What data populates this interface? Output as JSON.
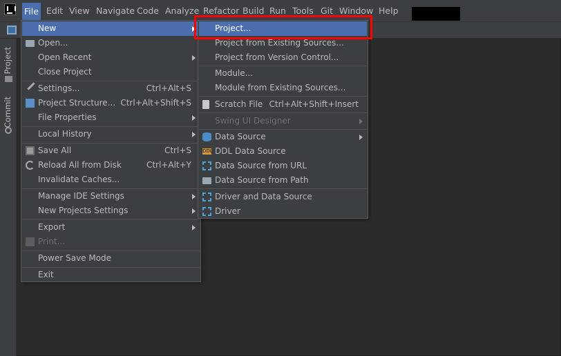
{
  "menubar": {
    "items": [
      {
        "label": "File"
      },
      {
        "label": "Edit"
      },
      {
        "label": "View"
      },
      {
        "label": "Navigate"
      },
      {
        "label": "Code"
      },
      {
        "label": "Analyze"
      },
      {
        "label": "Refactor"
      },
      {
        "label": "Build"
      },
      {
        "label": "Run"
      },
      {
        "label": "Tools"
      },
      {
        "label": "Git"
      },
      {
        "label": "Window"
      },
      {
        "label": "Help"
      }
    ]
  },
  "sidebar": {
    "tabs": [
      {
        "label": "Project"
      },
      {
        "label": "Commit"
      }
    ]
  },
  "file_menu": {
    "items": [
      {
        "label": "New",
        "shortcut": ""
      },
      {
        "label": "Open...",
        "shortcut": ""
      },
      {
        "label": "Open Recent",
        "shortcut": ""
      },
      {
        "label": "Close Project",
        "shortcut": ""
      },
      {
        "label": "Settings...",
        "shortcut": "Ctrl+Alt+S"
      },
      {
        "label": "Project Structure...",
        "shortcut": "Ctrl+Alt+Shift+S"
      },
      {
        "label": "File Properties",
        "shortcut": ""
      },
      {
        "label": "Local History",
        "shortcut": ""
      },
      {
        "label": "Save All",
        "shortcut": "Ctrl+S"
      },
      {
        "label": "Reload All from Disk",
        "shortcut": "Ctrl+Alt+Y"
      },
      {
        "label": "Invalidate Caches...",
        "shortcut": ""
      },
      {
        "label": "Manage IDE Settings",
        "shortcut": ""
      },
      {
        "label": "New Projects Settings",
        "shortcut": ""
      },
      {
        "label": "Export",
        "shortcut": ""
      },
      {
        "label": "Print...",
        "shortcut": ""
      },
      {
        "label": "Power Save Mode",
        "shortcut": ""
      },
      {
        "label": "Exit",
        "shortcut": ""
      }
    ]
  },
  "new_menu": {
    "items": [
      {
        "label": "Project...",
        "shortcut": ""
      },
      {
        "label": "Project from Existing Sources...",
        "shortcut": ""
      },
      {
        "label": "Project from Version Control...",
        "shortcut": ""
      },
      {
        "label": "Module...",
        "shortcut": ""
      },
      {
        "label": "Module from Existing Sources...",
        "shortcut": ""
      },
      {
        "label": "Scratch File",
        "shortcut": "Ctrl+Alt+Shift+Insert"
      },
      {
        "label": "Swing UI Designer",
        "shortcut": ""
      },
      {
        "label": "Data Source",
        "shortcut": ""
      },
      {
        "label": "DDL Data Source",
        "shortcut": ""
      },
      {
        "label": "Data Source from URL",
        "shortcut": ""
      },
      {
        "label": "Data Source from Path",
        "shortcut": ""
      },
      {
        "label": "Driver and Data Source",
        "shortcut": ""
      },
      {
        "label": "Driver",
        "shortcut": ""
      }
    ]
  },
  "icons": {
    "ddl_badge": "DDL"
  },
  "colors": {
    "selection": "#4b6eaf",
    "highlight_box": "#ff0000",
    "menu_bg": "#3c3f41",
    "editor_bg": "#2b2b2b"
  }
}
